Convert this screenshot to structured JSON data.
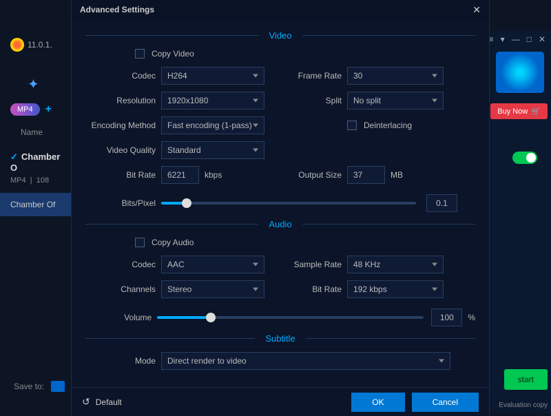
{
  "bg": {
    "logo": "11.0.1.",
    "mp4_badge": "MP4",
    "name_header": "Name",
    "item_title": "Chamber O",
    "item_sub_a": "MP4",
    "item_sub_b": "108",
    "selected": "Chamber Of",
    "save_to": "Save to:",
    "buy_now": "Buy Now",
    "start": "start",
    "eval": "Evaluation copy"
  },
  "modal": {
    "title": "Advanced Settings"
  },
  "video": {
    "section": "Video",
    "copy_video": "Copy Video",
    "codec_label": "Codec",
    "codec_value": "H264",
    "frame_rate_label": "Frame Rate",
    "frame_rate_value": "30",
    "resolution_label": "Resolution",
    "resolution_value": "1920x1080",
    "split_label": "Split",
    "split_value": "No split",
    "encoding_label": "Encoding Method",
    "encoding_value": "Fast encoding (1-pass)",
    "deinterlacing": "Deinterlacing",
    "quality_label": "Video Quality",
    "quality_value": "Standard",
    "bitrate_label": "Bit Rate",
    "bitrate_value": "6221",
    "bitrate_unit": "kbps",
    "outputsize_label": "Output Size",
    "outputsize_value": "37",
    "outputsize_unit": "MB",
    "bitspixel_label": "Bits/Pixel",
    "bitspixel_value": "0.1"
  },
  "audio": {
    "section": "Audio",
    "copy_audio": "Copy Audio",
    "codec_label": "Codec",
    "codec_value": "AAC",
    "sample_rate_label": "Sample Rate",
    "sample_rate_value": "48 KHz",
    "channels_label": "Channels",
    "channels_value": "Stereo",
    "bitrate_label": "Bit Rate",
    "bitrate_value": "192 kbps",
    "volume_label": "Volume",
    "volume_value": "100",
    "volume_unit": "%"
  },
  "subtitle": {
    "section": "Subtitle",
    "mode_label": "Mode",
    "mode_value": "Direct render to video"
  },
  "footer": {
    "default": "Default",
    "ok": "OK",
    "cancel": "Cancel"
  }
}
